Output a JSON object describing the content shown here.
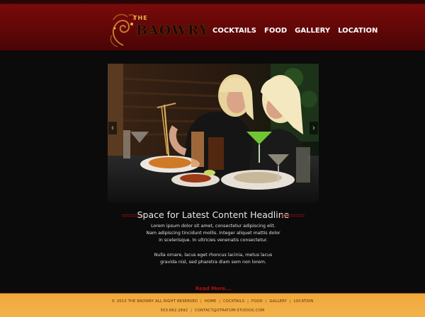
{
  "brand": {
    "name_small": "THE",
    "name_large": "BAOWRY",
    "colors": {
      "header_red": "#6a0909",
      "accent_gold": "#e8b24a",
      "footer_orange": "#f2ab42",
      "read_more_red": "#b30f0f"
    }
  },
  "nav": {
    "items": [
      {
        "label": "COCKTAILS"
      },
      {
        "label": "FOOD"
      },
      {
        "label": "GALLERY"
      },
      {
        "label": "LOCATION"
      }
    ]
  },
  "slider": {
    "prev_icon": "chevron-left-icon",
    "next_icon": "chevron-right-icon",
    "prev_glyph": "‹",
    "next_glyph": "›"
  },
  "content": {
    "headline": "Space for Latest Content Headline",
    "paragraph_1": "Lorem ipsum dolor sit amet, consectetur adipiscing elit. Nam adipiscing tincidunt mollis. Integer aliquet mattis dolor in scelerisque. In ultricies venenatis consectetur.",
    "paragraph_2": "Nulla ornare, lacus eget rhoncus lacinia, metus lacus gravida nisl, sed pharetra diam sem non lorem.",
    "read_more": "Read More..."
  },
  "footer": {
    "copyright": "© 2013 THE BAOWRY ALL RIGHT RESERVED",
    "links": [
      "HOME",
      "COCKTAILS",
      "FOOD",
      "GALLERY",
      "LOCATION"
    ],
    "phone": "503.662.2692",
    "email": "CONTACT@STRATUM-STUDIOS.COM",
    "separator": "|"
  }
}
